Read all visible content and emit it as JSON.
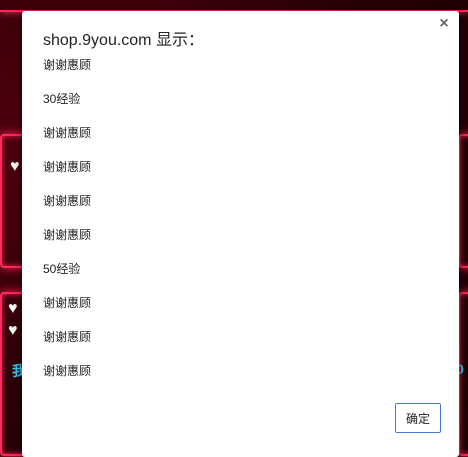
{
  "dialog": {
    "title": "shop.9you.com 显示：",
    "close_glyph": "×",
    "lines": [
      "谢谢惠顾",
      "30经验",
      "谢谢惠顾",
      "谢谢惠顾",
      "谢谢惠顾",
      "谢谢惠顾",
      "50经验",
      "谢谢惠顾",
      "谢谢惠顾",
      "谢谢惠顾"
    ],
    "ok_label": "确定"
  },
  "background": {
    "left_text": "我",
    "right_text": "0",
    "accent_color": "#ff2a5a",
    "text_color": "#3ad3ff"
  }
}
